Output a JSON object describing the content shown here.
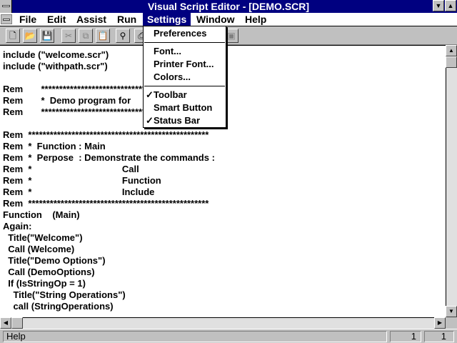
{
  "window": {
    "title": "Visual Script Editor - [DEMO.SCR]"
  },
  "menubar": {
    "items": [
      {
        "label": "File"
      },
      {
        "label": "Edit"
      },
      {
        "label": "Assist"
      },
      {
        "label": "Run"
      },
      {
        "label": "Settings"
      },
      {
        "label": "Window"
      },
      {
        "label": "Help"
      }
    ]
  },
  "settings_menu": {
    "items": [
      {
        "label": "Preferences",
        "checked": false
      },
      {
        "label": "Font...",
        "checked": false
      },
      {
        "label": "Printer Font...",
        "checked": false
      },
      {
        "label": "Colors...",
        "checked": false
      },
      {
        "label": "Toolbar",
        "checked": true
      },
      {
        "label": "Smart Button",
        "checked": false
      },
      {
        "label": "Status Bar",
        "checked": true
      }
    ],
    "check_glyph": "✓"
  },
  "toolbar": {
    "buttons": [
      {
        "icon": "new-file-icon",
        "glyph": "🗋"
      },
      {
        "icon": "open-folder-icon",
        "glyph": "📂"
      },
      {
        "icon": "save-disk-icon",
        "glyph": "💾"
      },
      {
        "icon": "cut-scissors-icon",
        "glyph": "✂"
      },
      {
        "icon": "copy-icon",
        "glyph": "⧉"
      },
      {
        "icon": "paste-icon",
        "glyph": "📋"
      },
      {
        "icon": "find-binoculars-icon",
        "glyph": "⚲"
      },
      {
        "icon": "print-icon",
        "glyph": "⎙"
      },
      {
        "icon": "run-icon",
        "glyph": "▣"
      }
    ]
  },
  "editor": {
    "lines": [
      "include (\"welcome.scr\")",
      "include (\"withpath.scr\")",
      "",
      "Rem       **********************************",
      "Rem       *  Demo program for",
      "Rem       **********************************",
      "",
      "Rem  **************************************************",
      "Rem  *  Function : Main",
      "Rem  *  Perpose  : Demonstrate the commands :",
      "Rem  *                                   Call",
      "Rem  *                                   Function",
      "Rem  *                                   Include",
      "Rem  **************************************************",
      "Function    (Main)",
      "Again:",
      "  Title(\"Welcome\")",
      "  Call (Welcome)",
      "  Title(\"Demo Options\")",
      "  Call (DemoOptions)",
      "  If (IsStringOp = 1)",
      "    Title(\"String Operations\")",
      "    call (StringOperations)"
    ]
  },
  "statusbar": {
    "message": "Help",
    "line": "1",
    "column": "1"
  }
}
